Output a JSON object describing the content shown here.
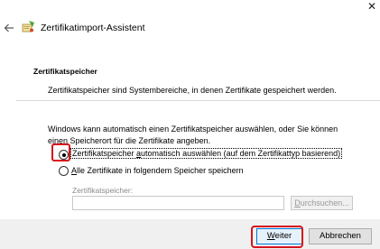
{
  "window": {
    "close_glyph": "✕",
    "title": "Zertifikatimport-Assistent"
  },
  "icons": {
    "back": "arrow-left-icon",
    "wizard": "certificate-import-wizard-icon",
    "close": "close-icon"
  },
  "header": {
    "title": "Zertifikatspeicher",
    "description": "Zertifikatspeicher sind Systembereiche, in denen Zertifikate gespeichert werden."
  },
  "body": {
    "intro": "Windows kann automatisch einen Zertifikatspeicher auswählen, oder Sie können einen Speicherort für die Zertifikate angeben.",
    "options": [
      {
        "pre": "Z",
        "underline": "",
        "text": "ertifikatspeicher ",
        "underline2": "a",
        "rest": "utomatisch auswählen (auf dem Zertifikattyp basierend)",
        "selected": true
      },
      {
        "pre": "",
        "underline": "A",
        "text": "lle Zertifikate in folgendem Speicher speichern",
        "selected": false
      }
    ],
    "store_label": "Zertifikatspeicher:",
    "store_value": "",
    "browse": {
      "underline": "D",
      "rest": "urchsuchen..."
    }
  },
  "footer": {
    "next": {
      "underline": "W",
      "rest": "eiter"
    },
    "cancel": "Abbrechen"
  },
  "colors": {
    "highlight": "#d5141c",
    "primary_button_border": "#0078d7",
    "footer_bg": "#f0f0f0"
  }
}
